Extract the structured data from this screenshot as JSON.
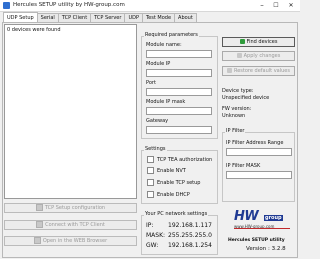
{
  "window": {
    "title": "Hercules SETUP utility by HW-group.com",
    "min": "–",
    "max": "☐",
    "close": "✕"
  },
  "tabs": [
    "UDP Setup",
    "Serial",
    "TCP Client",
    "TCP Server",
    "UDP",
    "Test Mode",
    "About"
  ],
  "device_list": {
    "empty_text": "0 devices were found",
    "buttons": [
      "TCP Setup configuration",
      "Connect with TCP Client",
      "Open in the WEB Browser"
    ]
  },
  "required": {
    "title": "Required parameters",
    "fields": [
      "Module name:",
      "Module IP",
      "Port",
      "Module IP mask",
      "Gateway"
    ]
  },
  "settings": {
    "title": "Settings",
    "options": [
      "TCP TEA authorization",
      "Enable NVT",
      "Enable TCP setup",
      "Enable DHCP"
    ]
  },
  "network": {
    "title": "Your PC network settings",
    "rows": [
      {
        "key": "IP:",
        "value": "192.168.1.117"
      },
      {
        "key": "MASK:",
        "value": "255.255.255.0"
      },
      {
        "key": "GW:",
        "value": "192.168.1.254"
      }
    ]
  },
  "actions": {
    "find": "Find devices",
    "apply": "Apply changes",
    "restore": "Restore default values"
  },
  "device_info": {
    "type_label": "Device type:",
    "type_value": "Unspecified device",
    "fw_label": "FW version:",
    "fw_value": "Unknown"
  },
  "ip_filter": {
    "title": "IP Filter",
    "range_label": "IP Filter Address Range",
    "mask_label": "IP Filter MASK"
  },
  "brand": {
    "logo_hw": "HW",
    "logo_group": "group",
    "url": "www.HW-group.com",
    "app_name": "Hercules SETUP utility",
    "version": "Version : 3.2.8"
  },
  "colors": {
    "brand_blue": "#1f3a93",
    "accent_red": "#c0282b",
    "find_icon": "#2e9b3a"
  }
}
